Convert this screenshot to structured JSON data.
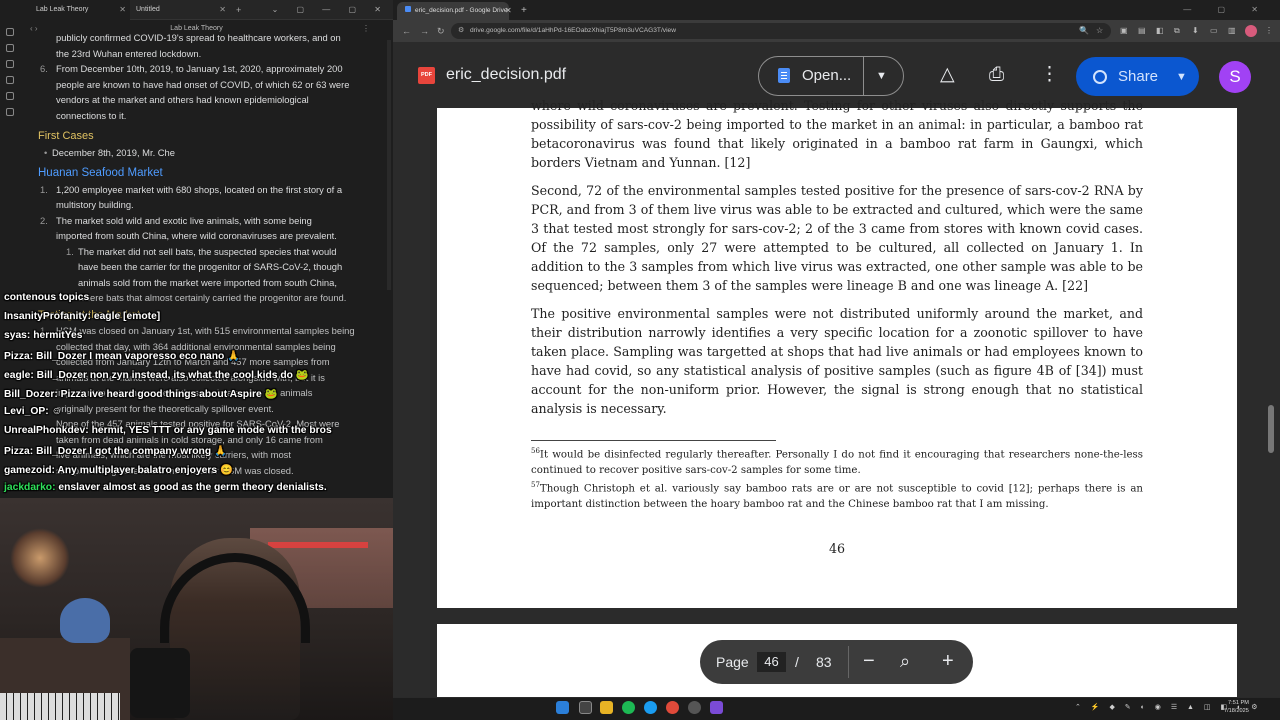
{
  "notes_app": {
    "tabs": [
      {
        "label": "Lab Leak Theory"
      },
      {
        "label": "Untitled"
      }
    ],
    "title": "Lab Leak Theory",
    "lines": {
      "l1": "publicly confirmed COVID-19's spread to healthcare workers, and on",
      "l2": "the 23rd Wuhan entered lockdown.",
      "item6_num": "6.",
      "item6_a": "From December 10th, 2019, to January 1st, 2020, approximately 200",
      "item6_b": "people are known to have had onset of COVID, of which 62 or 63 were",
      "item6_c": "vendors at the market and others had known epidemiological",
      "item6_d": "connections to it.",
      "h_first_cases": "First Cases",
      "first_case": "December 8th, 2019, Mr. Che",
      "h_huanan": "Huanan Seafood Market",
      "m1_num": "1.",
      "m1_a": "1,200 employee market with 680 shops, located on the first story of a",
      "m1_b": "multistory building.",
      "m2_num": "2.",
      "m2_a": "The market sold wild and exotic live animals, with some being",
      "m2_b": "imported from south China, where wild coronaviruses are prevalent.",
      "m2s_num": "1.",
      "m2s_a": "The market did not sell bats, the suspected species that would",
      "m2s_b": "have been the carrier for the progenitor of SARS-CoV-2, though",
      "m2s_c": "animals sold from the market were imported from south China,",
      "m2s_d": "where bats that almost certainly carried the progenitor are found.",
      "h_testing": "Testing at the Market",
      "t1_num": "1.",
      "t1_a": "HSM was closed on January 1st, with 515 environmental samples being",
      "t1_b": "collected that day, with 364 additional environmental samples being",
      "t1_c": "collected from January 12th to March and 457 more samples from",
      "t1_d": "animals at the market were also collected alongside with, but it is",
      "t1_e": "important to note that none of these animals were the animals",
      "t1_f": "originally present for the theoretically spillover event.",
      "t2_a": "None of the 457 animals tested positive for SARS-CoV-2. Most were",
      "t2_b": "taken from dead animals in cold storage, and only 16 came from",
      "t2_c": "live animals, which are the most likely carriers, with most",
      "t2_d": "samples being collected 2 months after HSM was closed."
    }
  },
  "chat": [
    {
      "user": "",
      "msg": "contenous topics"
    },
    {
      "user": "InsanityProfanity:",
      "msg": "eagle [emote]"
    },
    {
      "user": "syas:",
      "msg": "hermitYes"
    },
    {
      "user": "Pizza:",
      "msg": "Bill_Dozer I mean vaporesso eco nano"
    },
    {
      "user": "eagle:",
      "msg": "Bill_Dozer non zyn instead, its what the cool kids do"
    },
    {
      "user": "Bill_Dozer:",
      "msg": "Pizza ive heard good things about Aspire"
    },
    {
      "user": "Levi_OP:",
      "msg": ""
    },
    {
      "user": "UnrealPhonkdev:",
      "msg": "hermit, YES TTT or any game mode with the bros"
    },
    {
      "user": "Pizza:",
      "msg": "Bill_Dozer I got the company wrong"
    },
    {
      "user": "gamezoid:",
      "msg": "Any multiplayer balatro enjoyers"
    },
    {
      "user": "jackdarko:",
      "msg": "enslaver  almost as good as the germ theory denialists."
    }
  ],
  "browser": {
    "tab_title": "eric_decision.pdf - Google Drive",
    "url": "drive.google.com/file/d/1aHhPd-16EOabzXhiajT5P8m3uVCAG3T/view",
    "colors": {
      "accent": "#0b57d0",
      "avatar": "#a142f4",
      "pdf_red": "#e8453c"
    }
  },
  "viewer": {
    "filename": "eric_decision.pdf",
    "open_label": "Open...",
    "share_label": "Share",
    "avatar_letter": "S"
  },
  "pdf": {
    "p1_line0": "where wild coronaviruses are prevalent. Testing for other viruses also directly supports the possibility of sars-cov-2 being imported to the market in an animal: in particular, a bamboo rat betacoronavirus was found that likely originated in a bamboo rat farm in Gaungxi, which borders Vietnam and Yunnan. [12]",
    "p2": "Second, 72 of the environmental samples tested positive for the presence of sars-cov-2 RNA by PCR, and from 3 of them live virus was able to be extracted and cultured, which were the same 3 that tested most strongly for sars-cov-2; 2 of the 3 came from stores with known covid cases. Of the 72 samples, only 27 were attempted to be cultured, all collected on January 1. In addition to the 3 samples from which live virus was extracted, one other sample was able to be sequenced; between them 3 of the samples were lineage B and one was lineage A. [22]",
    "p3": "The positive environmental samples were not distributed uniformly around the market, and their distribution narrowly identifies a very specific location for a zoonotic spillover to have taken place. Sampling was targetted at shops that had live animals or had employees known to have had covid, so any statistical analysis of positive samples (such as figure 4B of [34]) must account for the non-uniform prior. However, the signal is strong enough that no statistical analysis is necessary.",
    "fn56_num": "56",
    "fn56": "It would be disinfected regularly thereafter. Personally I do not find it encouraging that researchers none-the-less continued to recover positive sars-cov-2 samples for some time.",
    "fn57_num": "57",
    "fn57": "Though Christoph et al. variously say bamboo rats are or are not susceptible to covid [12]; perhaps there is an important distinction between the hoary bamboo rat and the Chinese bamboo rat that I am missing.",
    "page_number": "46"
  },
  "pagenav": {
    "label": "Page",
    "current": "46",
    "slash": "/",
    "total": "83"
  },
  "taskbar": {
    "time": "7:51 PM",
    "date": "7/18/2025"
  }
}
